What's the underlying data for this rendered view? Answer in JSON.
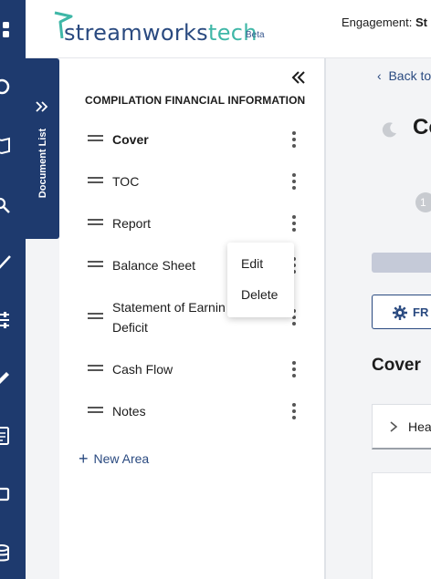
{
  "brand": {
    "name_part1": "streamworks",
    "name_part2": "tech",
    "badge": "Beta",
    "teal": "#3fb7a7",
    "navy": "#1e3a6e"
  },
  "header": {
    "engagement_label": "Engagement:",
    "engagement_value": "St"
  },
  "rail": {
    "icons": [
      "grid-icon",
      "refresh-icon",
      "book-icon",
      "search-doc-icon",
      "check-icon",
      "sliders-icon",
      "pen-icon",
      "document-icon",
      "box-icon",
      "database-icon"
    ]
  },
  "doc_tab": {
    "label": "Document List"
  },
  "panel": {
    "title": "COMPILATION FINANCIAL INFORMATION",
    "items": [
      {
        "label": "Cover",
        "selected": true
      },
      {
        "label": "TOC",
        "selected": false
      },
      {
        "label": "Report",
        "selected": false
      },
      {
        "label": "Balance Sheet",
        "selected": false
      },
      {
        "label": "Statement of Earnin",
        "label2": "Deficit",
        "selected": false
      },
      {
        "label": "Cash Flow",
        "selected": false
      },
      {
        "label": "Notes",
        "selected": false
      }
    ],
    "new_area": "New Area"
  },
  "context_menu": {
    "edit": "Edit",
    "delete": "Delete"
  },
  "content": {
    "back": "Back to",
    "title": "Co",
    "step": "1",
    "fr_button": "FR",
    "section_title": "Cover",
    "accordion_label": "Hea"
  }
}
